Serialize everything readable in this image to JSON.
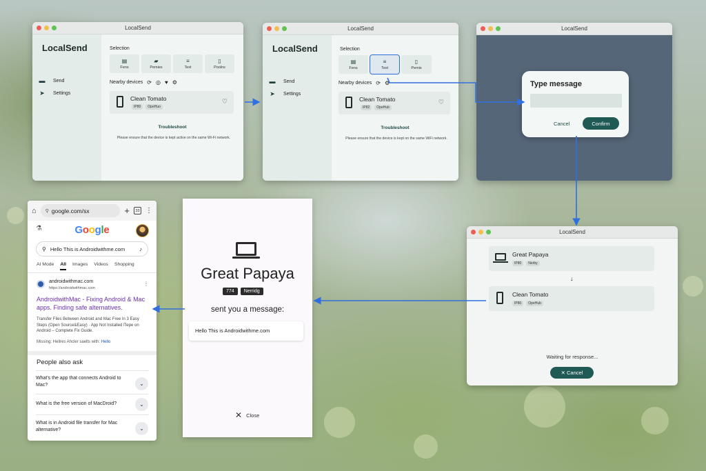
{
  "win1": {
    "title": "LocalSend",
    "logo": "LocalSend",
    "nav": [
      {
        "label": "Send",
        "icon": "send-nav-icon"
      },
      {
        "label": "Settings",
        "icon": "paper-plane-icon"
      }
    ],
    "selection_label": "Selection",
    "tiles": [
      "Fens",
      "Pemies",
      "Text",
      "Poolns"
    ],
    "nearby_label": "Nearby devices",
    "device": {
      "name": "Clean Tomato",
      "chips": [
        "IP80",
        "OpeHuo"
      ]
    },
    "troubleshoot": "Troubleshoot",
    "note": "Please ensure that the device is kept active on the same Wi-Fi network."
  },
  "win2": {
    "title": "LocalSend",
    "logo": "LocalSend",
    "nav": [
      {
        "label": "Send"
      },
      {
        "label": "Settings"
      }
    ],
    "selection_label": "Selection",
    "tiles": [
      "Fens",
      "Text",
      "Pemis"
    ],
    "highlighted_tile": "Text",
    "nearby_label": "Nearby devices",
    "device": {
      "name": "Clean Tomato",
      "chips": [
        "IP82",
        "OpeHub"
      ]
    },
    "troubleshoot": "Troubleshoot",
    "note": "Please ensure that the device is kept on the same WiFi network."
  },
  "win3": {
    "title": "LocalSend",
    "dialog": {
      "title": "Type message",
      "cancel": "Cancel",
      "confirm": "Confirm"
    }
  },
  "win4": {
    "title": "LocalSend",
    "sender": {
      "name": "Great Papaya",
      "chips": [
        "IP80",
        "Nerby"
      ]
    },
    "arrow": "↓",
    "receiver": {
      "name": "Clean Tomato",
      "chips": [
        "IP80",
        "OpeHub"
      ]
    },
    "status": "Waiting for response...",
    "cancel": "✕ Cancel"
  },
  "incoming": {
    "name": "Great Papaya",
    "chips": [
      "774",
      "Nerridg"
    ],
    "headline": "sent you a message:",
    "message": "Hello This is Androidwithme.com",
    "close": "Close"
  },
  "google": {
    "url": "google.com/sx",
    "tab_count": "33",
    "logo_letters": [
      "G",
      "o",
      "o",
      "g",
      "l",
      "e"
    ],
    "logo_colors": [
      "#4285f4",
      "#ea4335",
      "#fbbc05",
      "#4285f4",
      "#34a853",
      "#ea4335"
    ],
    "query": "Hello This is Androidwithme.com",
    "tabs": [
      "AI Mode",
      "All",
      "Images",
      "Videos",
      "Shopping"
    ],
    "active_tab": "All",
    "result": {
      "site": "androidwithmac.com",
      "site_url": "https://androidwithmac.com",
      "title": "AndroidwithMac - Fixing Android & Mac apps. Finding safe alternatives.",
      "snippet": "Transfer Files Between Android and Mac Free In 3 Easy Steps (Open Source&Easy) · App Not Installed Перe on Android – Complete Fix Guide.",
      "missing": "Missing: Hellres Ahcler saelts with:",
      "missing_link": "Hello"
    },
    "paa_title": "People also ask",
    "paa": [
      "What's the app that connects Android to Mac?",
      "What is the free version of MacDroid?",
      "What is in Android file transfer for Mac alternative?"
    ]
  }
}
